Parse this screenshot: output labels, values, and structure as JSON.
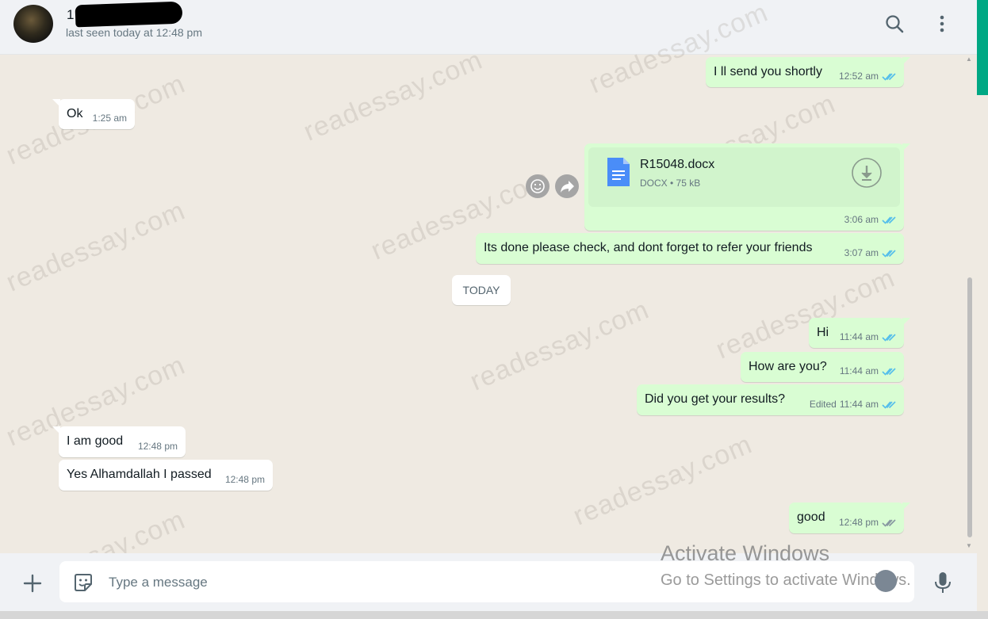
{
  "header": {
    "contact_name": "1 M",
    "last_seen": "last seen today at 12:48 pm",
    "search_icon": "search-icon",
    "menu_icon": "kebab-menu-icon"
  },
  "messages": [
    {
      "dir": "out",
      "text": "I ll send you shortly",
      "time": "12:52 am"
    },
    {
      "dir": "in",
      "text": "Ok",
      "time": "1:25 am"
    },
    {
      "dir": "out",
      "type": "document",
      "file_name": "R15048.docx",
      "file_info": "DOCX • 75 kB",
      "time": "3:06 am"
    },
    {
      "dir": "out",
      "text": "Its done please check, and dont forget to refer your friends",
      "time": "3:07 am"
    },
    {
      "dir": "out",
      "text": "Hi",
      "time": "11:44 am"
    },
    {
      "dir": "out",
      "text": "How are you?",
      "time": "11:44 am"
    },
    {
      "dir": "out",
      "text": "Did you get your results?",
      "edited": "Edited",
      "time": "11:44 am"
    },
    {
      "dir": "in",
      "text": "I am good",
      "time": "12:48 pm"
    },
    {
      "dir": "in",
      "text": "Yes Alhamdallah I passed",
      "time": "12:48 pm"
    },
    {
      "dir": "out",
      "text": "good",
      "time": "12:48 pm"
    }
  ],
  "day_separator": "TODAY",
  "watermark_text": "readessay.com",
  "composer": {
    "placeholder": "Type a message"
  },
  "windows_overlay": {
    "title": "Activate Windows",
    "subtitle": "Go to Settings to activate Windows."
  },
  "colors": {
    "outgoing_bubble": "#d9fdd3",
    "incoming_bubble": "#ffffff",
    "accent": "#00a884",
    "read_ticks": "#53bdeb"
  }
}
